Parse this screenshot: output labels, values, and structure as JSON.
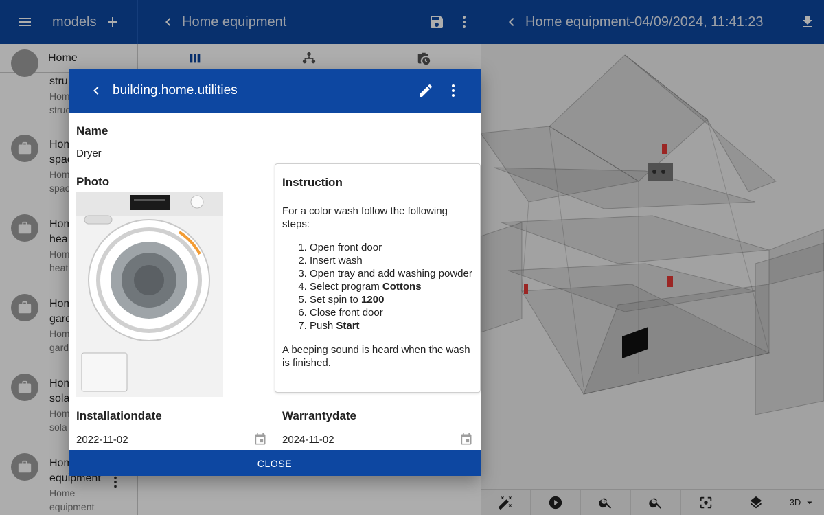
{
  "header1": {
    "title": "models"
  },
  "header2": {
    "title": "Home equipment"
  },
  "header3": {
    "title": "Home equipment-04/09/2024, 11:41:23"
  },
  "search": {
    "value": "Home"
  },
  "list": {
    "items": [
      {
        "line1": "",
        "line2": "",
        "line3": ""
      },
      {
        "line1": "stru",
        "line2": "Hom",
        "line3": "struc"
      },
      {
        "line1": "Hom",
        "line2": "spac",
        "line3": "Hom",
        "line4": "spac"
      },
      {
        "line1": "Hom",
        "line2": "hea",
        "line3": "Hom",
        "line4": "heat"
      },
      {
        "line1": "Hom",
        "line2": "gard",
        "line3": "Hom",
        "line4": "gard"
      },
      {
        "line1": "Hom",
        "line2": "sola",
        "line3": "Hom",
        "line4": "sola"
      },
      {
        "line1": "Hom",
        "line2": "equipment",
        "line3": "Home",
        "line4": "equipment"
      }
    ]
  },
  "dialog": {
    "title": "building.home.utilities",
    "name_label": "Name",
    "name_value": "Dryer",
    "photo_label": "Photo",
    "instruction": {
      "label": "Instruction",
      "intro": "For a color wash follow the following steps:",
      "steps": [
        {
          "text": "Open front door",
          "bold": ""
        },
        {
          "text": "Insert wash",
          "bold": ""
        },
        {
          "text": "Open tray and add washing powder",
          "bold": ""
        },
        {
          "text": "Select program ",
          "bold": "Cottons"
        },
        {
          "text": "Set spin to ",
          "bold": "1200"
        },
        {
          "text": "Close front door",
          "bold": ""
        },
        {
          "text": "Push ",
          "bold": "Start"
        }
      ],
      "outro": "A beeping sound is heard when the wash is finished."
    },
    "installation": {
      "label": "Installationdate",
      "value": "2022-11-02"
    },
    "warranty": {
      "label": "Warrantydate",
      "value": "2024-11-02"
    },
    "close_label": "CLOSE"
  },
  "viewer": {
    "mode": "3D"
  },
  "colors": {
    "primary": "#0d47a1",
    "marker_red": "#e53935"
  }
}
